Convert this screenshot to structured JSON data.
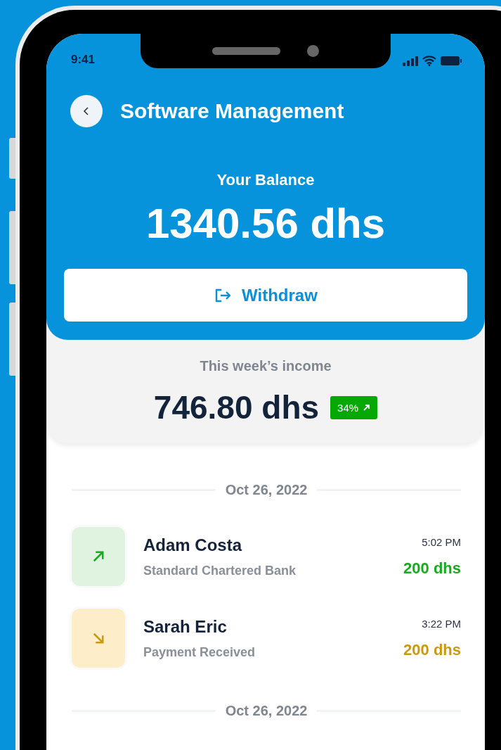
{
  "status_bar": {
    "time": "9:41"
  },
  "header": {
    "title": "Software Management"
  },
  "balance": {
    "label": "Your Balance",
    "amount": "1340.56 dhs"
  },
  "withdraw_button": {
    "label": "Withdraw"
  },
  "income": {
    "label": "This week’s income",
    "amount": "746.80 dhs",
    "change": "34%"
  },
  "groups": [
    {
      "date": "Oct 26, 2022",
      "transactions": [
        {
          "kind": "up",
          "name": "Adam Costa",
          "detail": "Standard Chartered Bank",
          "time": "5:02 PM",
          "amount": "200 dhs"
        },
        {
          "kind": "down",
          "name": "Sarah Eric",
          "detail": "Payment Received",
          "time": "3:22 PM",
          "amount": "200 dhs"
        }
      ]
    },
    {
      "date": "Oct 26, 2022"
    }
  ]
}
